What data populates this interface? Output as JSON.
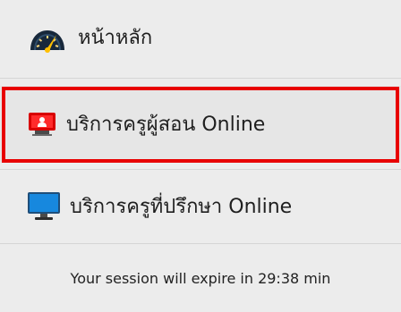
{
  "menu": {
    "items": [
      {
        "label": "หน้าหลัก",
        "icon": "dashboard-gauge-icon"
      },
      {
        "label": "บริการครูผู้สอน Online",
        "icon": "teacher-presentation-icon",
        "highlighted": true,
        "highlight_color": "#e80000"
      },
      {
        "label": "บริการครูที่ปรึกษา Online",
        "icon": "desktop-monitor-icon"
      }
    ]
  },
  "session": {
    "message": "Your session will expire in 29:38 min"
  },
  "colors": {
    "background": "#ececec",
    "highlight": "#e80000",
    "teacher_icon_red": "#d80000",
    "monitor_blue": "#1788de"
  }
}
